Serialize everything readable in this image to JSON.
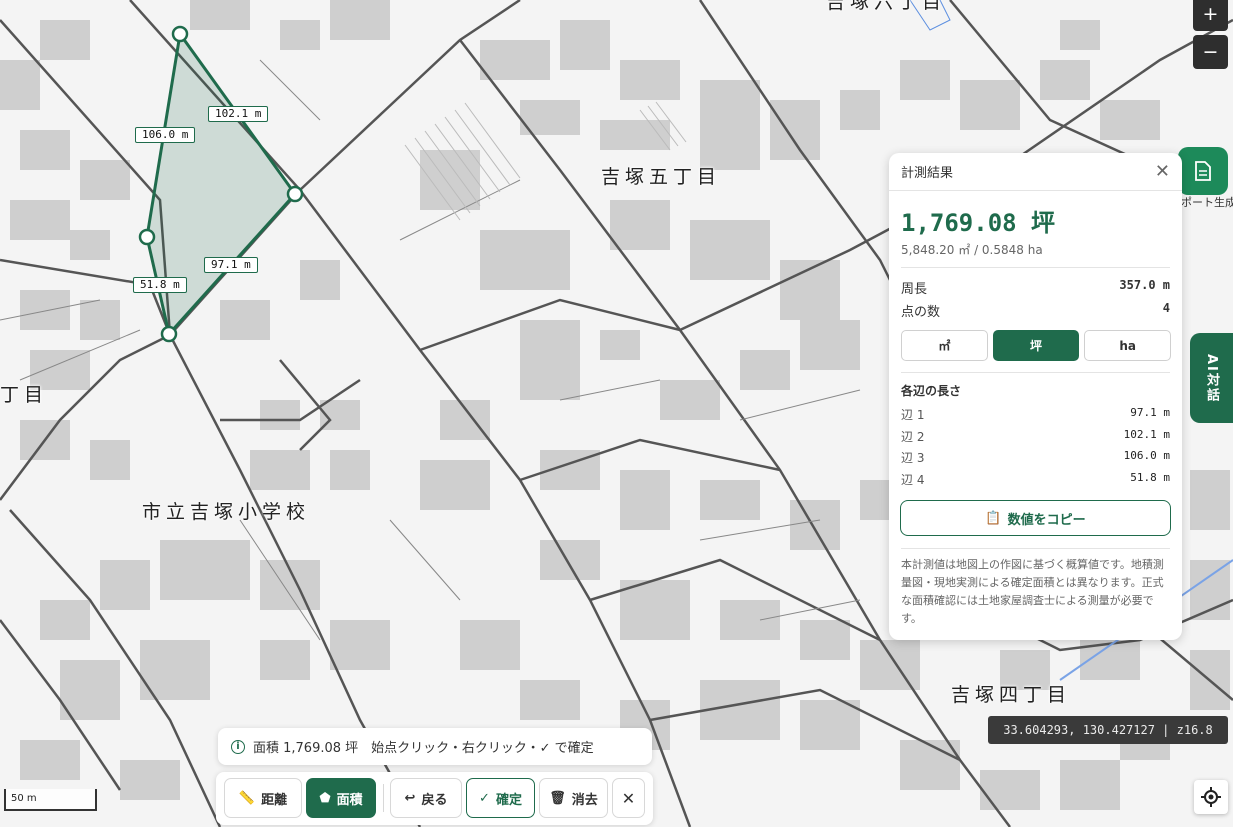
{
  "map": {
    "area_labels": [
      "吉塚五丁目",
      "吉塚四丁目",
      "市立吉塚小学校",
      "丁目",
      "吉塚六丁目"
    ],
    "edge_labels": [
      "102.1 m",
      "106.0 m",
      "97.1 m",
      "51.8 m"
    ],
    "polygon_color": "#1f6b4c"
  },
  "zoom": {
    "in_label": "+",
    "out_label": "−"
  },
  "report": {
    "label": "ポート生成",
    "icon": "document-icon"
  },
  "ai_tab": {
    "label": "AI対話"
  },
  "panel": {
    "title": "計測結果",
    "area_main": "1,769.08 坪",
    "area_sub": "5,848.20 ㎡ / 0.5848 ha",
    "perimeter_label": "周長",
    "perimeter_value": "357.0 m",
    "points_label": "点の数",
    "points_value": "4",
    "units": [
      "㎡",
      "坪",
      "ha"
    ],
    "active_unit": "坪",
    "edges_title": "各辺の長さ",
    "edges": [
      {
        "label": "辺 1",
        "value": "97.1 m"
      },
      {
        "label": "辺 2",
        "value": "102.1 m"
      },
      {
        "label": "辺 3",
        "value": "106.0 m"
      },
      {
        "label": "辺 4",
        "value": "51.8 m"
      }
    ],
    "copy_label": "数値をコピー",
    "disclaimer": "本計測値は地図上の作図に基づく概算値です。地積測量図・現地実測による確定面積とは異なります。正式な面積確認には土地家屋調査士による測量が必要です。"
  },
  "coords": "33.604293, 130.427127 | z16.8",
  "scale": "50 m",
  "status": {
    "text": "面積 1,769.08 坪　始点クリック・右クリック・✓ で確定"
  },
  "toolbar": {
    "distance": "距離",
    "area": "面積",
    "back": "戻る",
    "confirm": "確定",
    "clear": "消去",
    "close": "✕"
  },
  "colors": {
    "accent": "#1f6b4c",
    "report": "#1d8a5a"
  }
}
